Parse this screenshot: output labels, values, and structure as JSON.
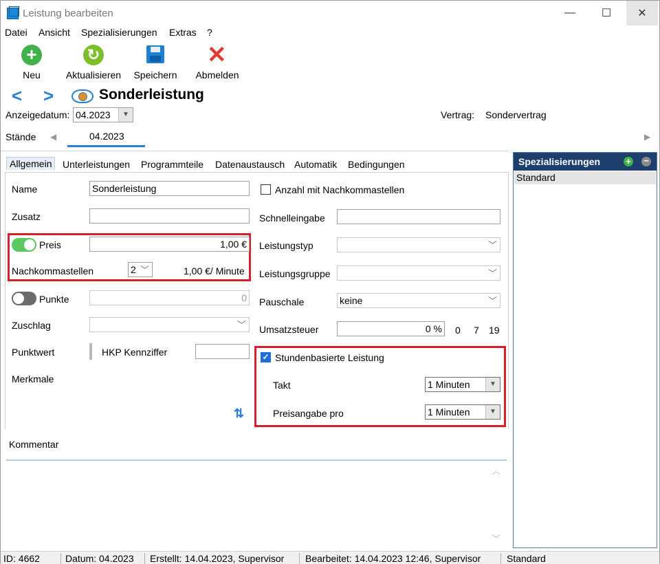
{
  "window": {
    "title": "Leistung bearbeiten",
    "minimize": "—",
    "maximize": "☐",
    "close": "✕"
  },
  "menu": [
    "Datei",
    "Ansicht",
    "Spezialisierungen",
    "Extras",
    "?"
  ],
  "toolbar": {
    "new_icon": "+",
    "refresh_icon": "↻",
    "logout_icon": "✕",
    "new": "Neu",
    "refresh": "Aktualisieren",
    "save": "Speichern",
    "logout": "Abmelden"
  },
  "nav": {
    "back": "<",
    "forward": ">",
    "title": "Sonderleistung"
  },
  "header": {
    "anzeigedatum_label": "Anzeigedatum:",
    "anzeigedatum_value": "04.2023",
    "vertrag_label": "Vertrag:",
    "vertrag_value": "Sondervertrag",
    "staende_label": "Stände",
    "staende_tab": "04.2023"
  },
  "tabs": [
    "Allgemein",
    "Unterleistungen",
    "Programmteile",
    "Datenaustausch",
    "Automatik",
    "Bedingungen"
  ],
  "left": {
    "name_label": "Name",
    "name_value": "Sonderleistung",
    "zusatz_label": "Zusatz",
    "zusatz_value": "",
    "preis_label": "Preis",
    "preis_on": true,
    "preis_value": "1,00 €",
    "nachkomma_label": "Nachkommastellen",
    "nachkomma_value": "2",
    "per_minute": "1,00 €/ Minute",
    "punkte_label": "Punkte",
    "punkte_on": false,
    "punkte_value": "0",
    "zuschlag_label": "Zuschlag",
    "punktwert_label": "Punktwert",
    "hkp_label": "HKP Kennziffer",
    "merkmale_label": "Merkmale",
    "sort_icon": "⇅"
  },
  "right": {
    "anzahl_label": "Anzahl mit Nachkommastellen",
    "anzahl_checked": false,
    "schnell_label": "Schnelleingabe",
    "typ_label": "Leistungstyp",
    "gruppe_label": "Leistungsgruppe",
    "pauschale_label": "Pauschale",
    "pauschale_value": "keine",
    "ust_label": "Umsatzsteuer",
    "ust_value": "0 %",
    "ust_q0": "0",
    "ust_q7": "7",
    "ust_q19": "19",
    "stunden_label": "Stundenbasierte Leistung",
    "stunden_checked": true,
    "takt_label": "Takt",
    "takt_value": "1 Minuten",
    "preisangabe_label": "Preisangabe pro",
    "preisangabe_value": "1 Minuten"
  },
  "kommentar_label": "Kommentar",
  "spez": {
    "title": "Spezialisierungen",
    "items": [
      "Standard"
    ]
  },
  "status": {
    "id": "ID: 4662",
    "datum": "Datum: 04.2023",
    "erstellt": "Erstellt: 14.04.2023, Supervisor",
    "bearbeitet": "Bearbeitet: 14.04.2023 12:46, Supervisor",
    "profil": "Standard"
  },
  "colors": {
    "accent": "#1d3f6e",
    "highlight": "#d81e28",
    "toggle_on": "#5bc862",
    "nav": "#2a7fd4"
  }
}
